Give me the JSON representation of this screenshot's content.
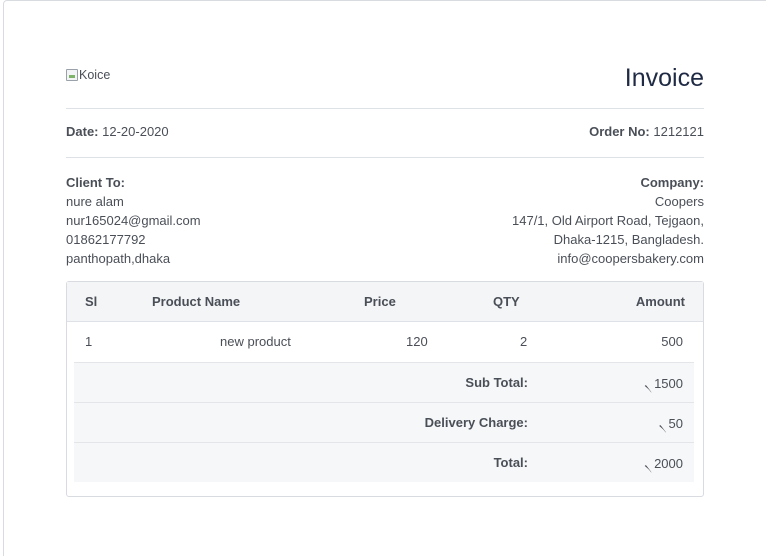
{
  "invoice": {
    "logo_alt": "Koice",
    "title": "Invoice",
    "date_label": "Date:",
    "date_value": "12-20-2020",
    "order_label": "Order No:",
    "order_value": "1212121"
  },
  "client": {
    "heading": "Client To:",
    "name": "nure alam",
    "email": "nur165024@gmail.com",
    "phone": "01862177792",
    "address": "panthopath,dhaka"
  },
  "company": {
    "heading": "Company:",
    "name": "Coopers",
    "address_line1": "147/1, Old Airport Road, Tejgaon,",
    "address_line2": "Dhaka-1215, Bangladesh.",
    "email": "info@coopersbakery.com"
  },
  "table": {
    "columns": [
      "Sl",
      "Product Name",
      "Price",
      "QTY",
      "Amount"
    ],
    "rows": [
      {
        "sl": "1",
        "product": "new product",
        "price": "120",
        "qty": "2",
        "amount": "500"
      }
    ],
    "currency_symbol": "৲",
    "sub_total_label": "Sub Total:",
    "sub_total_value": "1500",
    "delivery_label": "Delivery Charge:",
    "delivery_value": "50",
    "total_label": "Total:",
    "total_value": "2000"
  }
}
